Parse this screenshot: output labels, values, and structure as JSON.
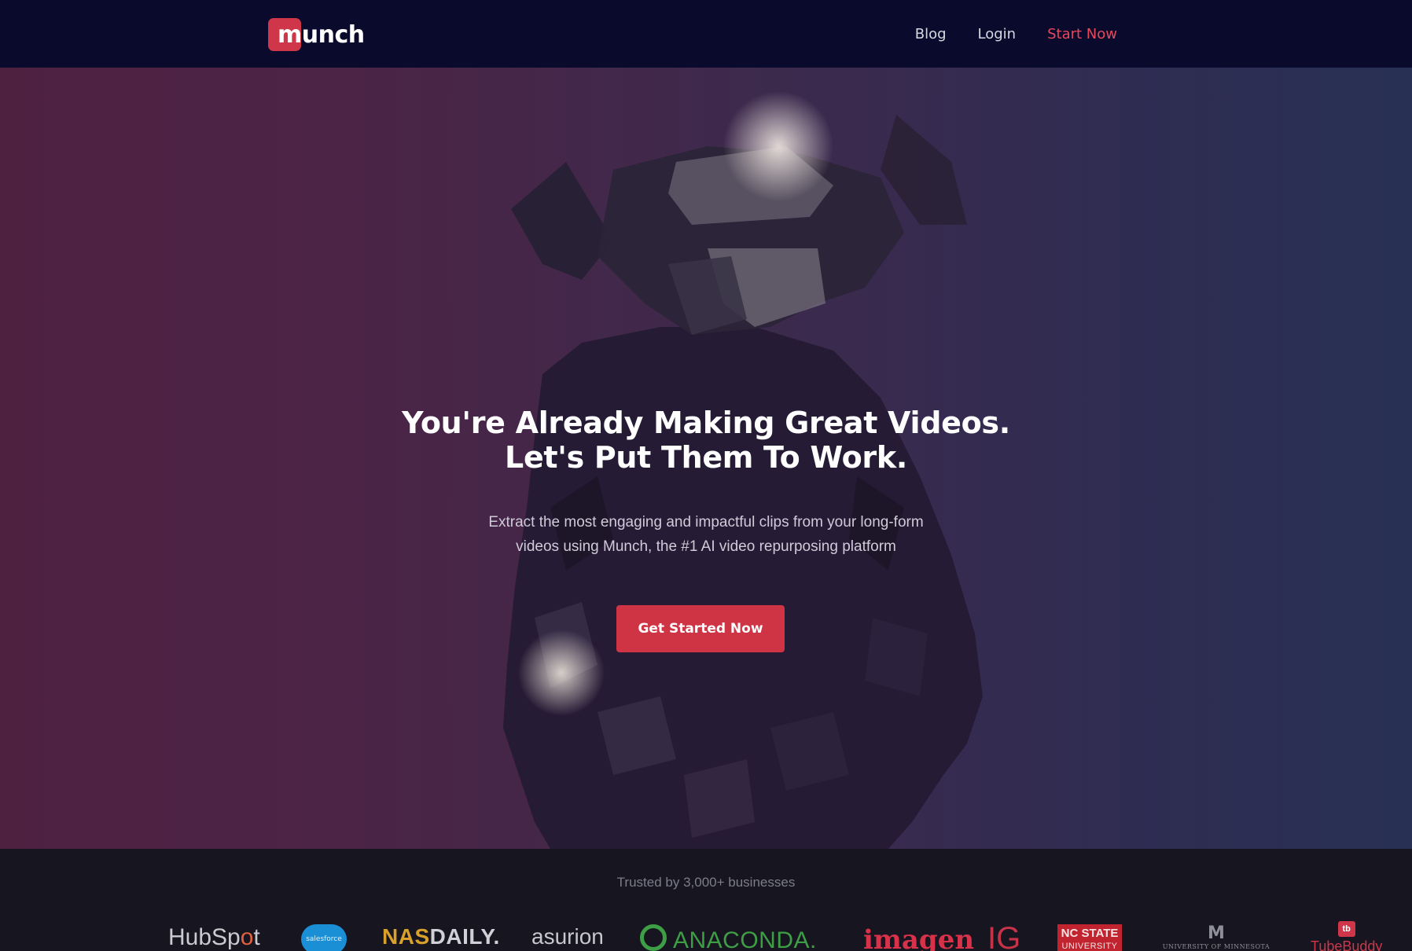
{
  "nav": {
    "logo_text": "munch",
    "links": [
      {
        "label": "Blog"
      },
      {
        "label": "Login"
      },
      {
        "label": "Start Now",
        "accent": true
      }
    ]
  },
  "hero": {
    "title_line1": "You're Already Making Great Videos.",
    "title_line2": "Let's Put Them To Work.",
    "subtitle_line1": "Extract the most engaging and impactful clips from your long-form",
    "subtitle_line2": "videos using Munch, the #1 AI video repurposing platform",
    "cta_label": "Get Started Now"
  },
  "trusted": {
    "label": "Trusted by 3,000+ businesses",
    "logos": {
      "hubspot_a": "HubSp",
      "hubspot_o": "o",
      "hubspot_b": "t",
      "salesforce": "salesforce",
      "nasdaily_a": "NAS",
      "nasdaily_b": "DAILY.",
      "asurion": "asurion",
      "anaconda": "ANACONDA.",
      "imagen": "imagen",
      "ig": "IG",
      "ncstate_a": "NC STATE",
      "ncstate_b": "UNIVERSITY",
      "umn_mark": "M",
      "umn_text": "UNIVERSITY OF MINNESOTA",
      "tube_icon": "tb",
      "tube_a": "Tube",
      "tube_b": "Buddy"
    }
  },
  "colors": {
    "nav_bg": "#0a0b2c",
    "accent": "#cf3444",
    "accent_link": "#e8485c",
    "trusted_bg": "#17151f"
  },
  "icons": {
    "logo": "munch-logo-mark"
  }
}
